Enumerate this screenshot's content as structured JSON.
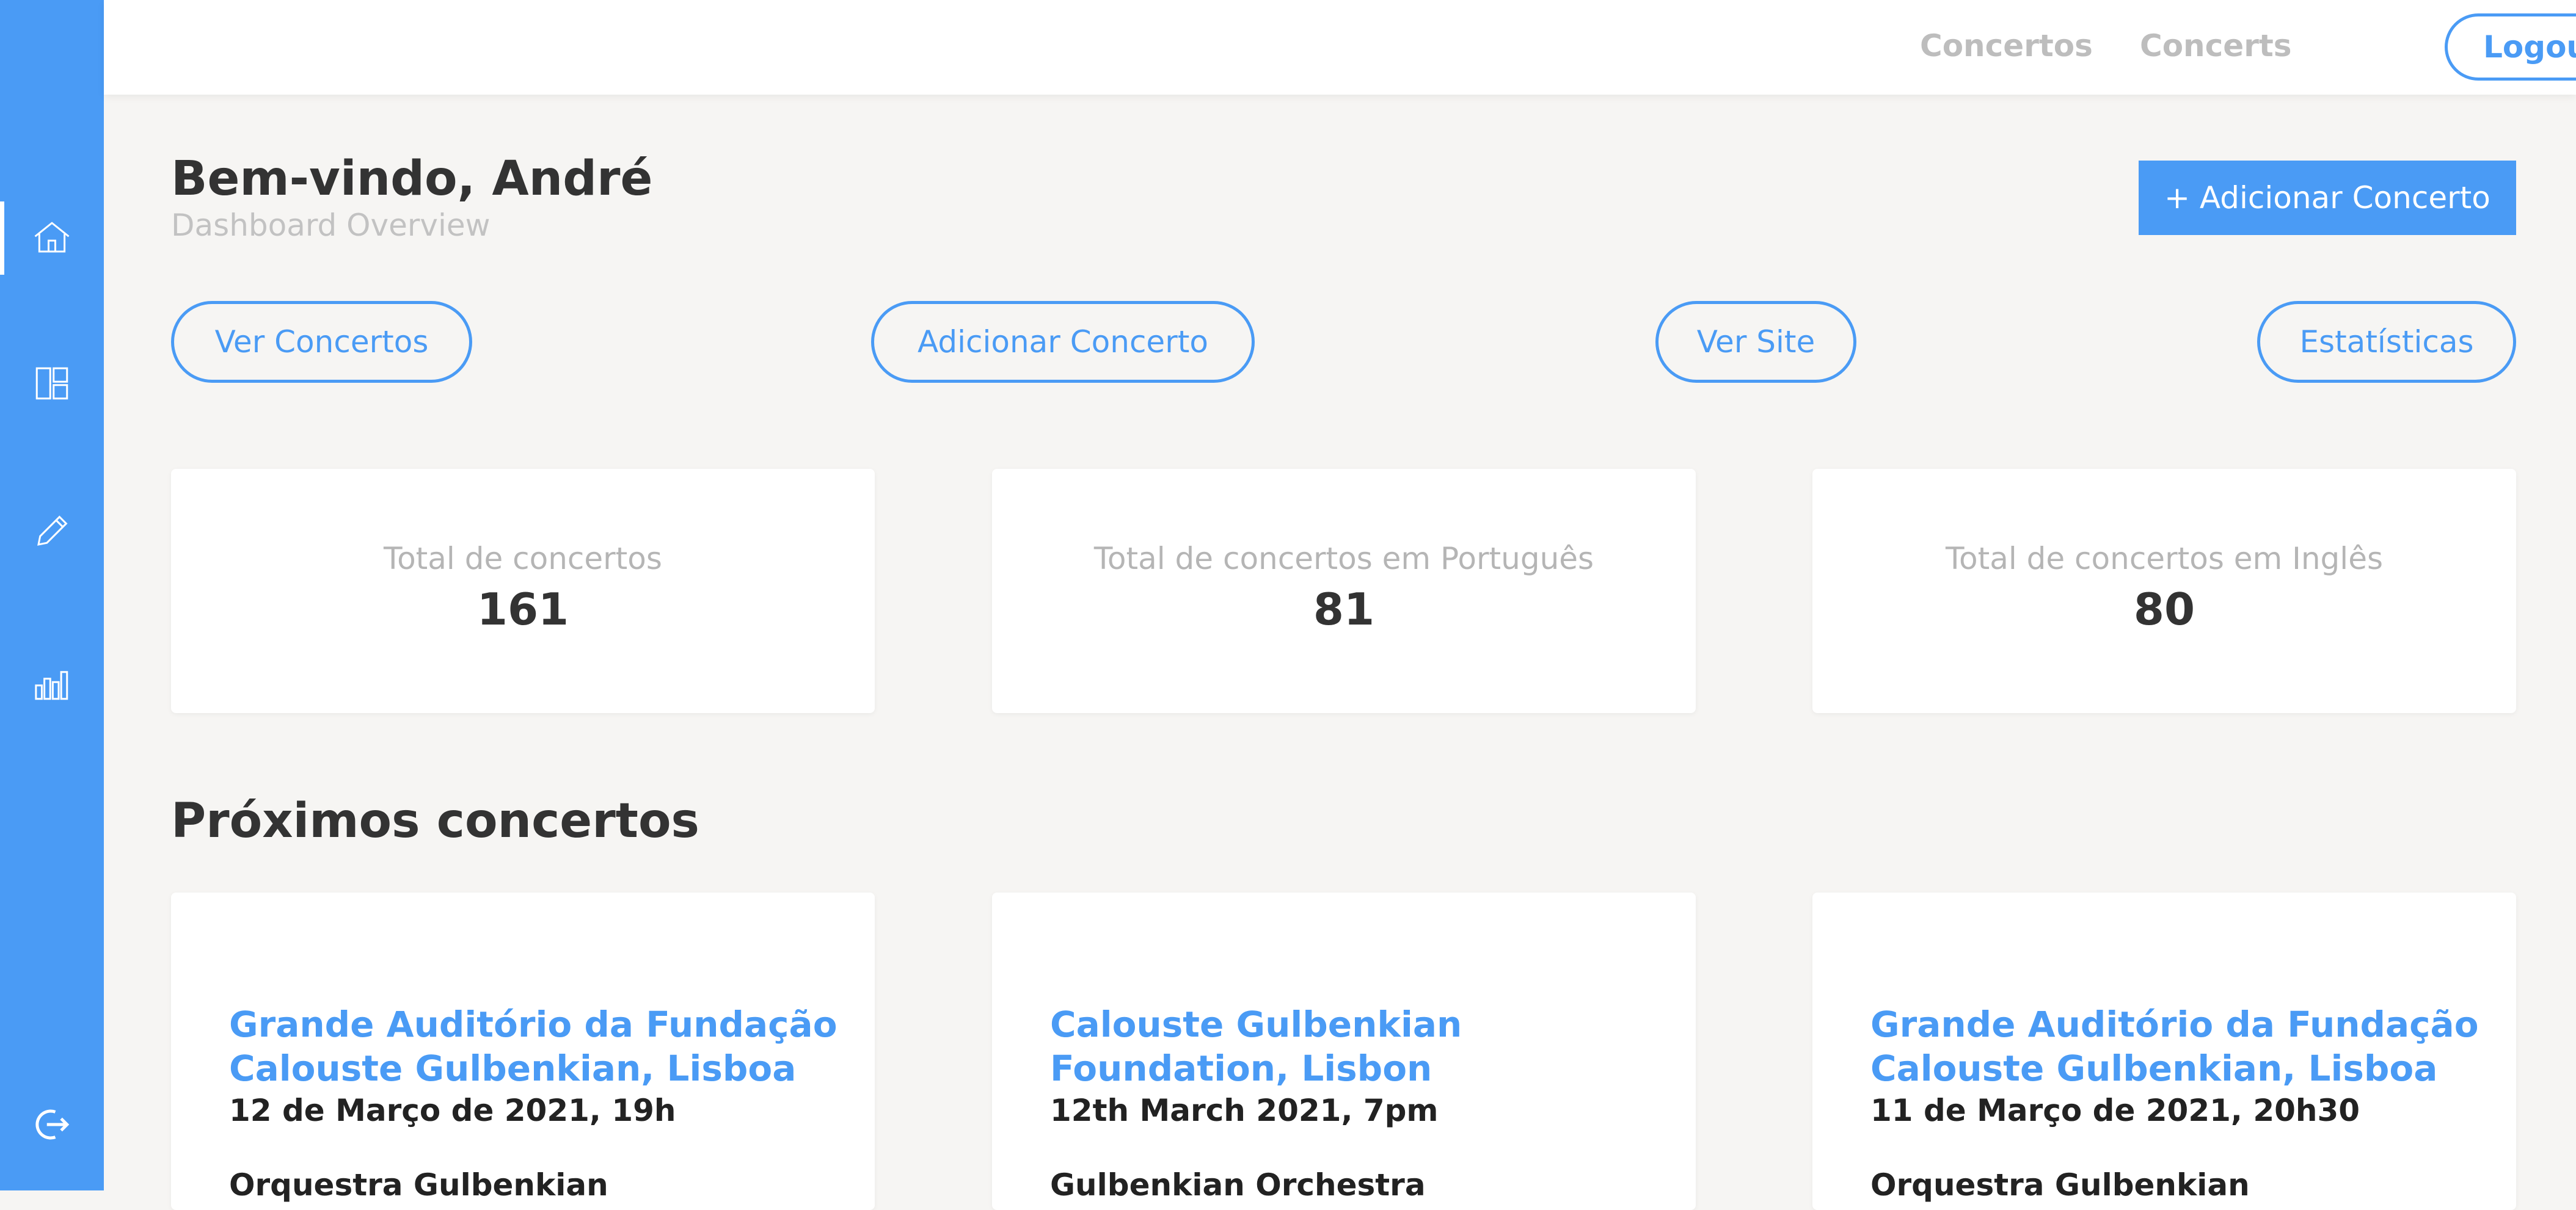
{
  "nav": {
    "links": [
      "Concertos",
      "Concerts"
    ],
    "logout_label": "Logout"
  },
  "sidebar": {
    "icons": [
      "home-icon",
      "dashboard-icon",
      "edit-icon",
      "stats-icon",
      "logout-icon"
    ],
    "accent_color": "#4a9bf5"
  },
  "header": {
    "welcome": "Bem-vindo, André",
    "subtitle": "Dashboard Overview",
    "add_button": "+ Adicionar Concerto"
  },
  "quick_actions": [
    "Ver Concertos",
    "Adicionar Concerto",
    "Ver Site",
    "Estatísticas"
  ],
  "stats": [
    {
      "label": "Total de concertos",
      "value": "161"
    },
    {
      "label": "Total de concertos em Português",
      "value": "81"
    },
    {
      "label": "Total de concertos em Inglês",
      "value": "80"
    }
  ],
  "upcoming": {
    "title": "Próximos concertos",
    "concerts": [
      {
        "venue": "Grande Auditório da Fundação Calouste Gulbenkian, Lisboa",
        "date": "12 de Março de 2021, 19h",
        "performer": "Orquestra Gulbenkian"
      },
      {
        "venue": "Calouste Gulbenkian Foundation, Lisbon",
        "date": "12th March 2021, 7pm",
        "performer": "Gulbenkian Orchestra"
      },
      {
        "venue": "Grande Auditório da Fundação Calouste Gulbenkian, Lisboa",
        "date": "11 de Março de 2021, 20h30",
        "performer": "Orquestra Gulbenkian"
      }
    ]
  }
}
